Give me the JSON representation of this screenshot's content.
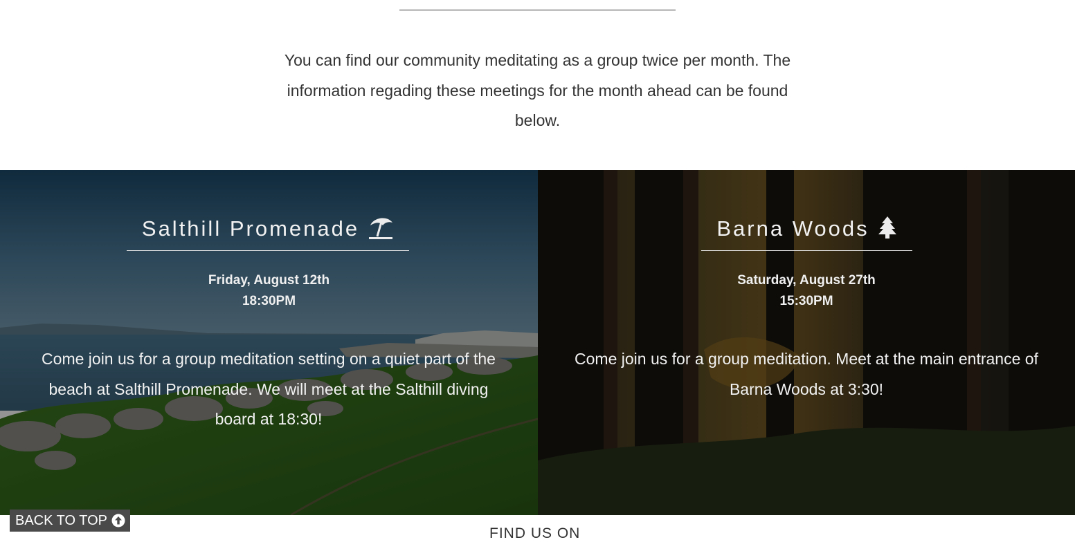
{
  "intro": {
    "text": "You can find our community meditating as a group twice per month. The information regading these meetings for the month ahead can be found below."
  },
  "meetings": [
    {
      "title": "Salthill Promenade",
      "icon": "beach-umbrella-icon",
      "date": "Friday, August 12th",
      "time": "18:30PM",
      "description": "Come join us for a group meditation setting on a quiet part of the beach at Salthill Promenade. We will meet at the Salthill diving board at 18:30!"
    },
    {
      "title": "Barna Woods",
      "icon": "tree-icon",
      "date": "Saturday, August 27th",
      "time": "15:30PM",
      "description": "Come join us for a group meditation. Meet at the main entrance of Barna Woods at 3:30!"
    }
  ],
  "back_to_top": {
    "label": "BACK TO TOP",
    "icon": "arrow-up-circle-icon"
  },
  "footer": {
    "find_us": "FIND US ON"
  },
  "colors": {
    "overlay": "#000000",
    "text_dark": "#333333",
    "button_bg": "#4a4a4a"
  }
}
